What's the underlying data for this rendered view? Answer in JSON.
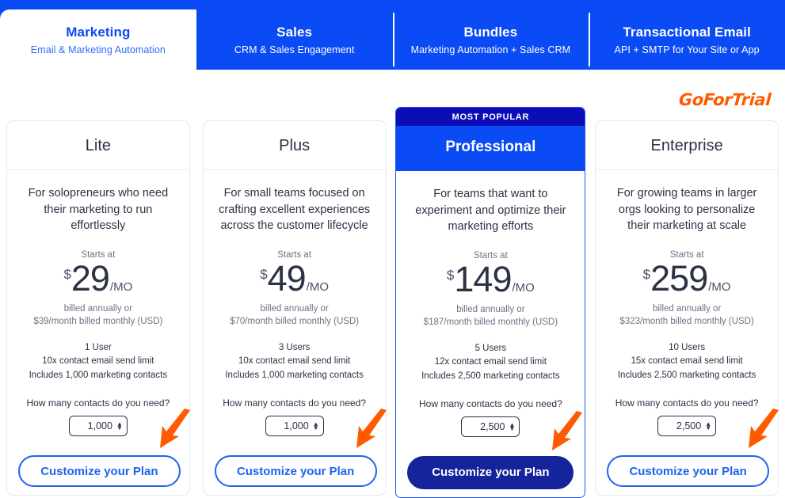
{
  "colors": {
    "brand_blue": "#0b4bf5",
    "deep_navy": "#16249c",
    "popular_navy": "#0d0db8",
    "accent_orange": "#ff5a00",
    "text_dark": "#2c3144",
    "text_muted": "#6b7385"
  },
  "watermark": {
    "text": "GoForTrial"
  },
  "tabs": [
    {
      "title": "Marketing",
      "subtitle": "Email & Marketing Automation",
      "active": true
    },
    {
      "title": "Sales",
      "subtitle": "CRM & Sales Engagement",
      "active": false
    },
    {
      "title": "Bundles",
      "subtitle": "Marketing Automation + Sales CRM",
      "active": false
    },
    {
      "title": "Transactional Email",
      "subtitle": "API + SMTP for Your Site or App",
      "active": false
    }
  ],
  "plans": [
    {
      "name": "Lite",
      "featured": false,
      "badge": "",
      "description": "For solopreneurs who need their marketing to run effortlessly",
      "starts_at_label": "Starts at",
      "currency": "$",
      "price": "29",
      "period": "/MO",
      "billing_line1": "billed annually or",
      "billing_line2": "$39/month billed monthly (USD)",
      "features": [
        "1 User",
        "10x contact email send limit",
        "Includes 1,000 marketing contacts"
      ],
      "contacts_question": "How many contacts do you need?",
      "contacts_value": "1,000",
      "cta_label": "Customize your Plan"
    },
    {
      "name": "Plus",
      "featured": false,
      "badge": "",
      "description": "For small teams focused on crafting excellent experiences across the customer lifecycle",
      "starts_at_label": "Starts at",
      "currency": "$",
      "price": "49",
      "period": "/MO",
      "billing_line1": "billed annually or",
      "billing_line2": "$70/month billed monthly (USD)",
      "features": [
        "3 Users",
        "10x contact email send limit",
        "Includes 1,000 marketing contacts"
      ],
      "contacts_question": "How many contacts do you need?",
      "contacts_value": "1,000",
      "cta_label": "Customize your Plan"
    },
    {
      "name": "Professional",
      "featured": true,
      "badge": "MOST POPULAR",
      "description": "For teams that want to experiment and optimize their marketing efforts",
      "starts_at_label": "Starts at",
      "currency": "$",
      "price": "149",
      "period": "/MO",
      "billing_line1": "billed annually or",
      "billing_line2": "$187/month billed monthly (USD)",
      "features": [
        "5 Users",
        "12x contact email send limit",
        "Includes 2,500 marketing contacts"
      ],
      "contacts_question": "How many contacts do you need?",
      "contacts_value": "2,500",
      "cta_label": "Customize your Plan"
    },
    {
      "name": "Enterprise",
      "featured": false,
      "badge": "",
      "description": "For growing teams in larger orgs looking to personalize their marketing at scale",
      "starts_at_label": "Starts at",
      "currency": "$",
      "price": "259",
      "period": "/MO",
      "billing_line1": "billed annually or",
      "billing_line2": "$323/month billed monthly (USD)",
      "features": [
        "10 Users",
        "15x contact email send limit",
        "Includes 2,500 marketing contacts"
      ],
      "contacts_question": "How many contacts do you need?",
      "contacts_value": "2,500",
      "cta_label": "Customize your Plan"
    }
  ],
  "stepper_icons": {
    "up": "▲",
    "down": "▼"
  }
}
